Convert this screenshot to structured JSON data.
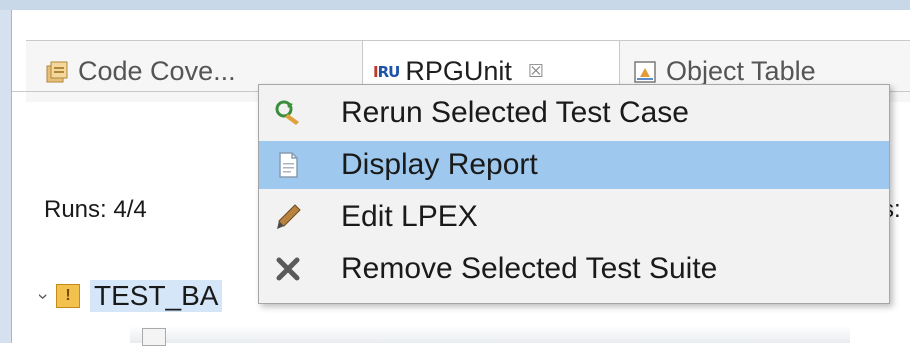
{
  "tabs": [
    {
      "label": "Code Cove...",
      "icon": "code-coverage-icon"
    },
    {
      "label": "RPGUnit",
      "icon": "rpgunit-icon",
      "close": "☒"
    },
    {
      "label": "Object Table",
      "icon": "object-table-icon"
    }
  ],
  "rpgunit_logo": {
    "prefix": "I",
    "text": "RU"
  },
  "status": {
    "runs": "Runs: 4/4",
    "right_fragment": "s:"
  },
  "tree": {
    "item_label": "TEST_BA",
    "status_icon": "warning-icon",
    "expanded": true
  },
  "context_menu": {
    "items": [
      {
        "label": "Rerun Selected Test Case",
        "icon": "rerun-icon",
        "highlighted": false
      },
      {
        "label": "Display Report",
        "icon": "report-document-icon",
        "highlighted": true
      },
      {
        "label": "Edit LPEX",
        "icon": "pencil-icon",
        "highlighted": false
      },
      {
        "label": "Remove Selected Test Suite",
        "icon": "remove-x-icon",
        "highlighted": false
      }
    ]
  },
  "colors": {
    "highlight": "#9fc8ee",
    "menu_bg": "#f2f2f2",
    "frame": "#d5e1ee",
    "tree_selection": "#d5e6f8"
  }
}
